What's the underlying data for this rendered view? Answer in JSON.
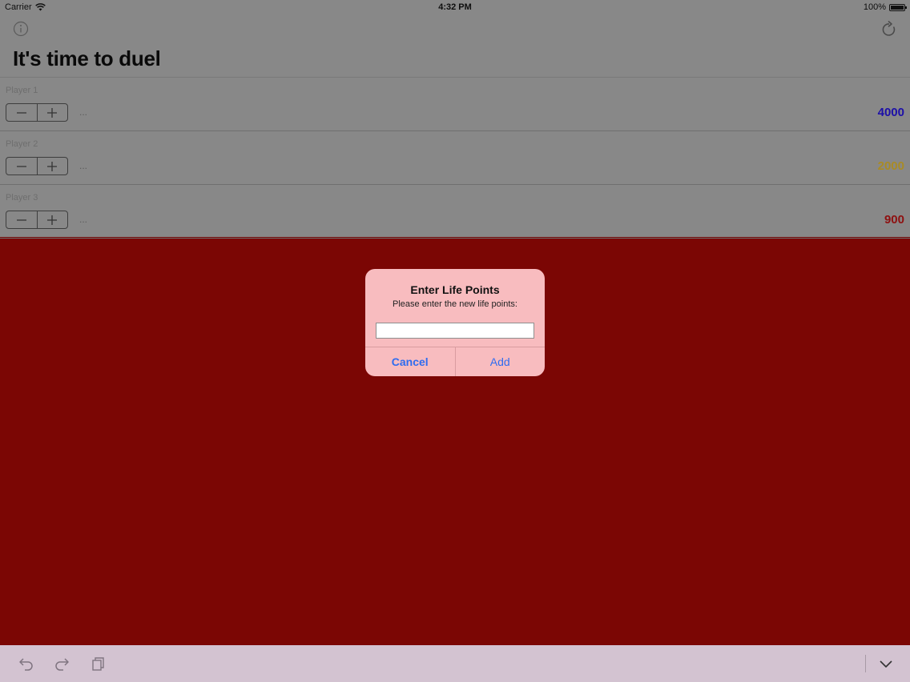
{
  "status_bar": {
    "carrier": "Carrier",
    "time": "4:32 PM",
    "battery": "100%",
    "battery_level": 1.0
  },
  "nav": {
    "info_icon": "info-icon",
    "refresh_icon": "refresh-icon",
    "title": "It's time to duel"
  },
  "players": [
    {
      "name": "Player 1",
      "ellipsis": "...",
      "points": "4000",
      "color": "#1c0fa8"
    },
    {
      "name": "Player 2",
      "ellipsis": "...",
      "points": "2000",
      "color": "#a98b25"
    },
    {
      "name": "Player 3",
      "ellipsis": "...",
      "points": "900",
      "color": "#8e1010"
    }
  ],
  "alert": {
    "title": "Enter Life Points",
    "message": "Please enter the new life points:",
    "input_value": "",
    "cancel_label": "Cancel",
    "add_label": "Add"
  },
  "toolbar": {
    "icons": [
      "undo-icon",
      "redo-icon",
      "copy-icon",
      "chevron-down-icon"
    ]
  },
  "colors": {
    "background": "#7b0604",
    "alert_background": "#f8bcbf",
    "button_blue": "#2f6cf0"
  }
}
